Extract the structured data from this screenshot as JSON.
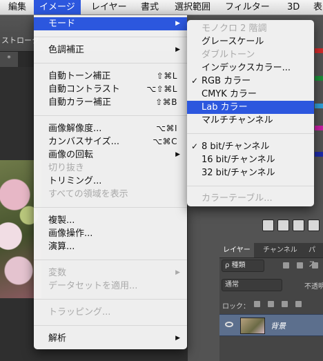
{
  "menubar": {
    "items": [
      "編集",
      "イメージ",
      "レイヤー",
      "書式",
      "選択範囲",
      "フィルター",
      "3D",
      "表"
    ],
    "active_index": 1
  },
  "app": {
    "toolbar_label": "ストローク",
    "doc_tab": "*",
    "layers_panel": {
      "tabs": [
        "レイヤー",
        "チャンネル",
        "パス"
      ],
      "filter_kind": "ρ 種類",
      "blend_mode": "通常",
      "opacity_label": "不透明",
      "lock_label": "ロック：",
      "layer_name": "背景"
    }
  },
  "image_menu": {
    "items": [
      {
        "label": "モード",
        "arrow": true,
        "highlight": true
      },
      {
        "label": "色調補正",
        "arrow": true
      },
      {
        "label": "自動トーン補正",
        "shortcut": "⇧⌘L"
      },
      {
        "label": "自動コントラスト",
        "shortcut": "⌥⇧⌘L"
      },
      {
        "label": "自動カラー補正",
        "shortcut": "⇧⌘B"
      },
      {
        "label": "画像解像度...",
        "shortcut": "⌥⌘I"
      },
      {
        "label": "カンバスサイズ...",
        "shortcut": "⌥⌘C"
      },
      {
        "label": "画像の回転",
        "arrow": true
      },
      {
        "label": "切り抜き",
        "disabled": true
      },
      {
        "label": "トリミング..."
      },
      {
        "label": "すべての領域を表示",
        "disabled": true
      },
      {
        "label": "複製..."
      },
      {
        "label": "画像操作..."
      },
      {
        "label": "演算..."
      },
      {
        "label": "変数",
        "arrow": true,
        "disabled": true
      },
      {
        "label": "データセットを適用...",
        "disabled": true
      },
      {
        "label": "トラッピング...",
        "disabled": true
      },
      {
        "label": "解析",
        "arrow": true
      }
    ]
  },
  "mode_submenu": {
    "items": [
      {
        "label": "モノクロ 2 階調",
        "disabled": true
      },
      {
        "label": "グレースケール"
      },
      {
        "label": "ダブルトーン",
        "disabled": true
      },
      {
        "label": "インデックスカラー..."
      },
      {
        "label": "RGB カラー",
        "checked": true
      },
      {
        "label": "CMYK カラー"
      },
      {
        "label": "Lab カラー",
        "highlight": true
      },
      {
        "label": "マルチチャンネル"
      },
      {
        "label": "8 bit/チャンネル",
        "checked": true
      },
      {
        "label": "16 bit/チャンネル"
      },
      {
        "label": "32 bit/チャンネル"
      },
      {
        "label": "カラーテーブル...",
        "disabled": true
      }
    ]
  },
  "colors": {
    "highlight": "#2c57de",
    "menu_bg": "#f5f5f5",
    "disabled_text": "#a9a9a9"
  },
  "icons": {
    "checkmark": "checkmark-icon",
    "submenu_arrow": "triangle-right-icon"
  }
}
